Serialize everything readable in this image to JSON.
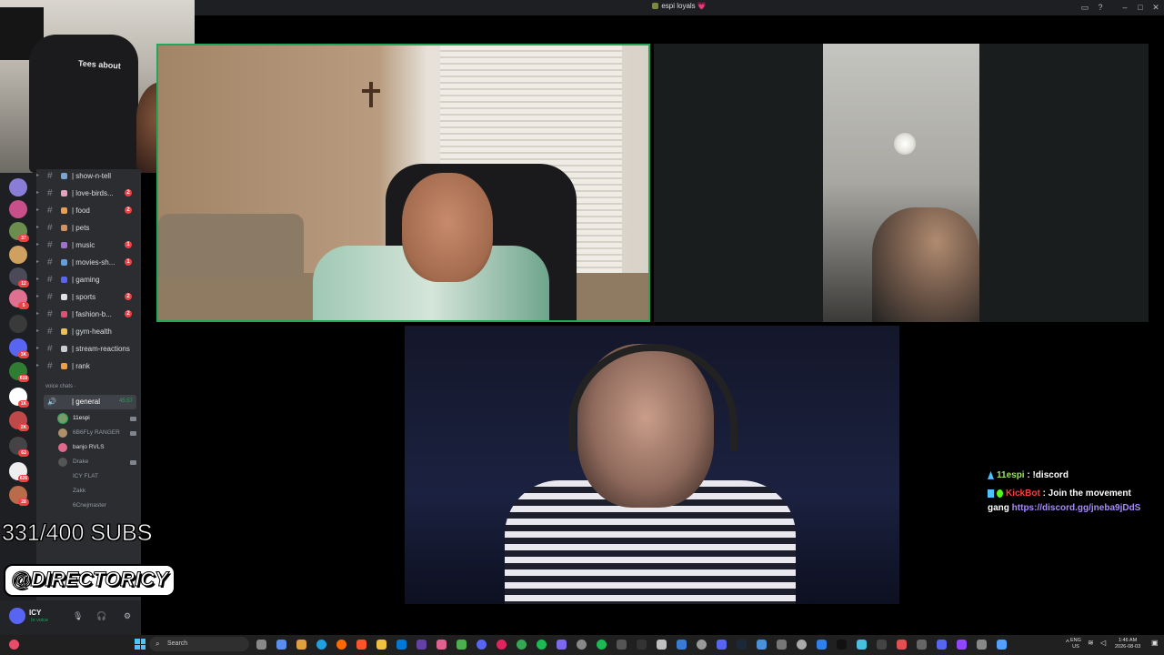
{
  "window": {
    "title": "espi loyals",
    "title_heart": "💗"
  },
  "webcam": {
    "chair_text": "Tees about"
  },
  "sidebar": {
    "guild_badges": [
      "37",
      "12",
      "5",
      "3K",
      "619",
      "1K",
      "2K",
      "63",
      "626",
      "28"
    ],
    "channels": [
      {
        "name": "| show-n-tell",
        "count": ""
      },
      {
        "name": "| love-birds...",
        "count": "2"
      },
      {
        "name": "| food",
        "count": "2"
      },
      {
        "name": "| pets",
        "count": ""
      },
      {
        "name": "| music",
        "count": "1"
      },
      {
        "name": "| movies-sh...",
        "count": "1"
      },
      {
        "name": "| gaming",
        "count": ""
      },
      {
        "name": "| sports",
        "count": "2"
      },
      {
        "name": "| fashion-b...",
        "count": "2"
      },
      {
        "name": "| gym-health",
        "count": ""
      },
      {
        "name": "| stream-reactions",
        "count": ""
      },
      {
        "name": "| rank",
        "count": ""
      }
    ],
    "voice_section": "voice chats ·",
    "voice_channel": {
      "name": "| general",
      "time": "45:57"
    },
    "voice_users": [
      {
        "name": "11espi"
      },
      {
        "name": "6B6FLy RANGER"
      },
      {
        "name": "banjo RVLS"
      },
      {
        "name": "Drake"
      },
      {
        "name": "ICY FLAT"
      },
      {
        "name": "Zakk"
      },
      {
        "name": "6Cnejmaster"
      }
    ],
    "user_panel": {
      "name": "ICY",
      "status": "In voice"
    }
  },
  "overlay": {
    "subs": "331/400 SUBS",
    "handle": "@DIRECTORICY"
  },
  "chat": {
    "messages": [
      {
        "user": "11espi",
        "text": " : !discord"
      },
      {
        "user": "KickBot",
        "text": " : Join the movement",
        "cont": "gang ",
        "link": "https://discord.gg/jneba9jDdS"
      }
    ]
  },
  "taskbar": {
    "search_placeholder": "Search",
    "lang": "ENG",
    "region": "US",
    "time": "1:46 AM",
    "date": "2026-08-03"
  },
  "colors": {
    "speaking": "#23a55a",
    "discord_bg": "#2b2d31",
    "mention_red": "#f23f43",
    "link": "#a78bfa"
  }
}
